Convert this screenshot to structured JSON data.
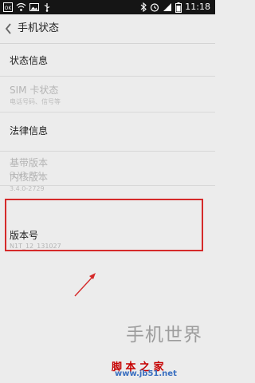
{
  "status_bar": {
    "time": "11:18",
    "icons_left": [
      "ok-box-icon",
      "wifi-icon",
      "image-icon",
      "usb-icon"
    ],
    "icons_right": [
      "bluetooth-icon",
      "alarm-icon",
      "signal-icon",
      "battery-icon"
    ]
  },
  "header": {
    "title": "手机状态"
  },
  "items": [
    {
      "title": "状态信息",
      "subtitle": "",
      "enabled": true
    },
    {
      "title": "SIM 卡状态",
      "subtitle": "电话号码、信号等",
      "enabled": false
    },
    {
      "title": "法律信息",
      "subtitle": "",
      "enabled": true
    },
    {
      "title": "基带版本",
      "subtitle": "Q_V1_P14",
      "enabled": false
    },
    {
      "title": "内核版本",
      "subtitle": "3.4.0-2729",
      "enabled": false
    },
    {
      "title": "版本号",
      "subtitle": "N1T_12_131027",
      "enabled": true
    }
  ],
  "watermark": {
    "big": "手机世界",
    "site": "脚 本 之 家",
    "url": "www.jb51.net"
  },
  "colors": {
    "highlight": "#d52a2a",
    "status_bar_bg": "#151515",
    "background": "#ececec"
  }
}
